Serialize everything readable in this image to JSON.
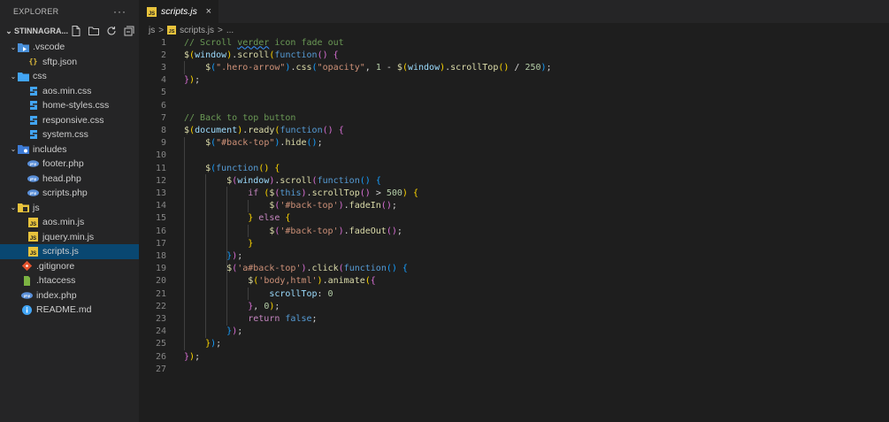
{
  "sidebar": {
    "title": "EXPLORER",
    "more": "···",
    "folder": "STINNAGRA...",
    "items": [
      {
        "label": ".vscode",
        "kind": "folder",
        "level": 0,
        "icon": "vscode-folder-icon",
        "open": true
      },
      {
        "label": "sftp.json",
        "kind": "file",
        "level": 1,
        "icon": "json-file-icon"
      },
      {
        "label": "css",
        "kind": "folder",
        "level": 0,
        "icon": "css-folder-icon",
        "open": true
      },
      {
        "label": "aos.min.css",
        "kind": "file",
        "level": 1,
        "icon": "css-file-icon"
      },
      {
        "label": "home-styles.css",
        "kind": "file",
        "level": 1,
        "icon": "css-file-icon"
      },
      {
        "label": "responsive.css",
        "kind": "file",
        "level": 1,
        "icon": "css-file-icon"
      },
      {
        "label": "system.css",
        "kind": "file",
        "level": 1,
        "icon": "css-file-icon"
      },
      {
        "label": "includes",
        "kind": "folder",
        "level": 0,
        "icon": "includes-folder-icon",
        "open": true
      },
      {
        "label": "footer.php",
        "kind": "file",
        "level": 1,
        "icon": "php-file-icon"
      },
      {
        "label": "head.php",
        "kind": "file",
        "level": 1,
        "icon": "php-file-icon"
      },
      {
        "label": "scripts.php",
        "kind": "file",
        "level": 1,
        "icon": "php-file-icon"
      },
      {
        "label": "js",
        "kind": "folder",
        "level": 0,
        "icon": "js-folder-icon",
        "open": true
      },
      {
        "label": "aos.min.js",
        "kind": "file",
        "level": 1,
        "icon": "js-file-icon"
      },
      {
        "label": "jquery.min.js",
        "kind": "file",
        "level": 1,
        "icon": "js-file-icon"
      },
      {
        "label": "scripts.js",
        "kind": "file",
        "level": 1,
        "icon": "js-file-icon",
        "selected": true
      },
      {
        "label": ".gitignore",
        "kind": "file",
        "level": 0,
        "icon": "git-file-icon"
      },
      {
        "label": ".htaccess",
        "kind": "file",
        "level": 0,
        "icon": "htaccess-file-icon"
      },
      {
        "label": "index.php",
        "kind": "file",
        "level": 0,
        "icon": "php-file-icon"
      },
      {
        "label": "README.md",
        "kind": "file",
        "level": 0,
        "icon": "info-file-icon"
      }
    ]
  },
  "tab": {
    "label": "scripts.js",
    "close": "×",
    "icon": "js-file-icon"
  },
  "breadcrumb": {
    "folder": "js",
    "sep": ">",
    "file": "scripts.js",
    "more": "..."
  },
  "editor": {
    "lines": [
      {
        "no": "1",
        "indent": 0,
        "tokens": [
          [
            "c",
            "// Scroll "
          ],
          [
            "c sq",
            "verder"
          ],
          [
            "c",
            " icon fade out"
          ]
        ]
      },
      {
        "no": "2",
        "indent": 0,
        "tokens": [
          [
            "f",
            "$"
          ],
          [
            "p1",
            "("
          ],
          [
            "v",
            "window"
          ],
          [
            "p1",
            ")"
          ],
          [
            "w",
            "."
          ],
          [
            "f",
            "scroll"
          ],
          [
            "p1",
            "("
          ],
          [
            "k",
            "function"
          ],
          [
            "p2",
            "()"
          ],
          [
            "w",
            " "
          ],
          [
            "p2",
            "{"
          ]
        ]
      },
      {
        "no": "3",
        "indent": 1,
        "tokens": [
          [
            "f",
            "$"
          ],
          [
            "p3",
            "("
          ],
          [
            "s",
            "\".hero-arrow\""
          ],
          [
            "p3",
            ")"
          ],
          [
            "w",
            "."
          ],
          [
            "f",
            "css"
          ],
          [
            "p3",
            "("
          ],
          [
            "s",
            "\"opacity\""
          ],
          [
            "w",
            ", "
          ],
          [
            "n",
            "1"
          ],
          [
            "w",
            " - "
          ],
          [
            "f",
            "$"
          ],
          [
            "p1",
            "("
          ],
          [
            "v",
            "window"
          ],
          [
            "p1",
            ")"
          ],
          [
            "w",
            "."
          ],
          [
            "f",
            "scrollTop"
          ],
          [
            "p1",
            "()"
          ],
          [
            "w",
            " / "
          ],
          [
            "n",
            "250"
          ],
          [
            "p3",
            ")"
          ],
          [
            "w",
            ";"
          ]
        ]
      },
      {
        "no": "4",
        "indent": 0,
        "tokens": [
          [
            "p2",
            "}"
          ],
          [
            "p1",
            ")"
          ],
          [
            "w",
            ";"
          ]
        ]
      },
      {
        "no": "5",
        "indent": 0,
        "tokens": []
      },
      {
        "no": "6",
        "indent": 0,
        "tokens": []
      },
      {
        "no": "7",
        "indent": 0,
        "tokens": [
          [
            "c",
            "// Back to top button"
          ]
        ]
      },
      {
        "no": "8",
        "indent": 0,
        "tokens": [
          [
            "f",
            "$"
          ],
          [
            "p1",
            "("
          ],
          [
            "v",
            "document"
          ],
          [
            "p1",
            ")"
          ],
          [
            "w",
            "."
          ],
          [
            "f",
            "ready"
          ],
          [
            "p1",
            "("
          ],
          [
            "k",
            "function"
          ],
          [
            "p2",
            "()"
          ],
          [
            "w",
            " "
          ],
          [
            "p2",
            "{"
          ]
        ]
      },
      {
        "no": "9",
        "indent": 1,
        "tokens": [
          [
            "f",
            "$"
          ],
          [
            "p3",
            "("
          ],
          [
            "s",
            "\"#back-top\""
          ],
          [
            "p3",
            ")"
          ],
          [
            "w",
            "."
          ],
          [
            "f",
            "hide"
          ],
          [
            "p3",
            "()"
          ],
          [
            "w",
            ";"
          ]
        ]
      },
      {
        "no": "10",
        "indent": 0,
        "tokens": []
      },
      {
        "no": "11",
        "indent": 1,
        "tokens": [
          [
            "f",
            "$"
          ],
          [
            "p3",
            "("
          ],
          [
            "k",
            "function"
          ],
          [
            "p1",
            "()"
          ],
          [
            "w",
            " "
          ],
          [
            "p1",
            "{"
          ]
        ]
      },
      {
        "no": "12",
        "indent": 2,
        "tokens": [
          [
            "f",
            "$"
          ],
          [
            "p2",
            "("
          ],
          [
            "v",
            "window"
          ],
          [
            "p2",
            ")"
          ],
          [
            "w",
            "."
          ],
          [
            "f",
            "scroll"
          ],
          [
            "p2",
            "("
          ],
          [
            "k",
            "function"
          ],
          [
            "p3",
            "()"
          ],
          [
            "w",
            " "
          ],
          [
            "p3",
            "{"
          ]
        ]
      },
      {
        "no": "13",
        "indent": 3,
        "tokens": [
          [
            "ctl",
            "if"
          ],
          [
            "w",
            " "
          ],
          [
            "p1",
            "("
          ],
          [
            "f",
            "$"
          ],
          [
            "p2",
            "("
          ],
          [
            "k",
            "this"
          ],
          [
            "p2",
            ")"
          ],
          [
            "w",
            "."
          ],
          [
            "f",
            "scrollTop"
          ],
          [
            "p2",
            "()"
          ],
          [
            "w",
            " > "
          ],
          [
            "n",
            "500"
          ],
          [
            "p1",
            ")"
          ],
          [
            "w",
            " "
          ],
          [
            "p1",
            "{"
          ]
        ]
      },
      {
        "no": "14",
        "indent": 4,
        "tokens": [
          [
            "f",
            "$"
          ],
          [
            "p2",
            "("
          ],
          [
            "s",
            "'#back-top'"
          ],
          [
            "p2",
            ")"
          ],
          [
            "w",
            "."
          ],
          [
            "f",
            "fadeIn"
          ],
          [
            "p2",
            "()"
          ],
          [
            "w",
            ";"
          ]
        ]
      },
      {
        "no": "15",
        "indent": 3,
        "tokens": [
          [
            "p1",
            "}"
          ],
          [
            "w",
            " "
          ],
          [
            "ctl",
            "else"
          ],
          [
            "w",
            " "
          ],
          [
            "p1",
            "{"
          ]
        ]
      },
      {
        "no": "16",
        "indent": 4,
        "tokens": [
          [
            "f",
            "$"
          ],
          [
            "p2",
            "("
          ],
          [
            "s",
            "'#back-top'"
          ],
          [
            "p2",
            ")"
          ],
          [
            "w",
            "."
          ],
          [
            "f",
            "fadeOut"
          ],
          [
            "p2",
            "()"
          ],
          [
            "w",
            ";"
          ]
        ]
      },
      {
        "no": "17",
        "indent": 3,
        "tokens": [
          [
            "p1",
            "}"
          ]
        ]
      },
      {
        "no": "18",
        "indent": 2,
        "tokens": [
          [
            "p3",
            "}"
          ],
          [
            "p2",
            ")"
          ],
          [
            "w",
            ";"
          ]
        ]
      },
      {
        "no": "19",
        "indent": 2,
        "tokens": [
          [
            "f",
            "$"
          ],
          [
            "p2",
            "("
          ],
          [
            "s",
            "'a#back-top'"
          ],
          [
            "p2",
            ")"
          ],
          [
            "w",
            "."
          ],
          [
            "f",
            "click"
          ],
          [
            "p2",
            "("
          ],
          [
            "k",
            "function"
          ],
          [
            "p3",
            "()"
          ],
          [
            "w",
            " "
          ],
          [
            "p3",
            "{"
          ]
        ]
      },
      {
        "no": "20",
        "indent": 3,
        "tokens": [
          [
            "f",
            "$"
          ],
          [
            "p1",
            "("
          ],
          [
            "s",
            "'body,html'"
          ],
          [
            "p1",
            ")"
          ],
          [
            "w",
            "."
          ],
          [
            "f",
            "animate"
          ],
          [
            "p1",
            "("
          ],
          [
            "p2",
            "{"
          ]
        ]
      },
      {
        "no": "21",
        "indent": 4,
        "tokens": [
          [
            "v",
            "scrollTop"
          ],
          [
            "w",
            ": "
          ],
          [
            "n",
            "0"
          ]
        ]
      },
      {
        "no": "22",
        "indent": 3,
        "tokens": [
          [
            "p2",
            "}"
          ],
          [
            "w",
            ", "
          ],
          [
            "n",
            "0"
          ],
          [
            "p1",
            ")"
          ],
          [
            "w",
            ";"
          ]
        ]
      },
      {
        "no": "23",
        "indent": 3,
        "tokens": [
          [
            "ctl",
            "return"
          ],
          [
            "w",
            " "
          ],
          [
            "k",
            "false"
          ],
          [
            "w",
            ";"
          ]
        ]
      },
      {
        "no": "24",
        "indent": 2,
        "tokens": [
          [
            "p3",
            "}"
          ],
          [
            "p2",
            ")"
          ],
          [
            "w",
            ";"
          ]
        ]
      },
      {
        "no": "25",
        "indent": 1,
        "tokens": [
          [
            "p1",
            "}"
          ],
          [
            "p3",
            ")"
          ],
          [
            "w",
            ";"
          ]
        ]
      },
      {
        "no": "26",
        "indent": 0,
        "tokens": [
          [
            "p2",
            "}"
          ],
          [
            "p1",
            ")"
          ],
          [
            "w",
            ";"
          ]
        ]
      },
      {
        "no": "27",
        "indent": 0,
        "tokens": []
      }
    ]
  },
  "colors": {
    "bg": "#1e1e1e",
    "sidebar": "#252526",
    "selection": "#094771",
    "js_icon": "#e8c33c",
    "css_icon": "#42a5f5",
    "php_icon": "#5a8fd8"
  }
}
